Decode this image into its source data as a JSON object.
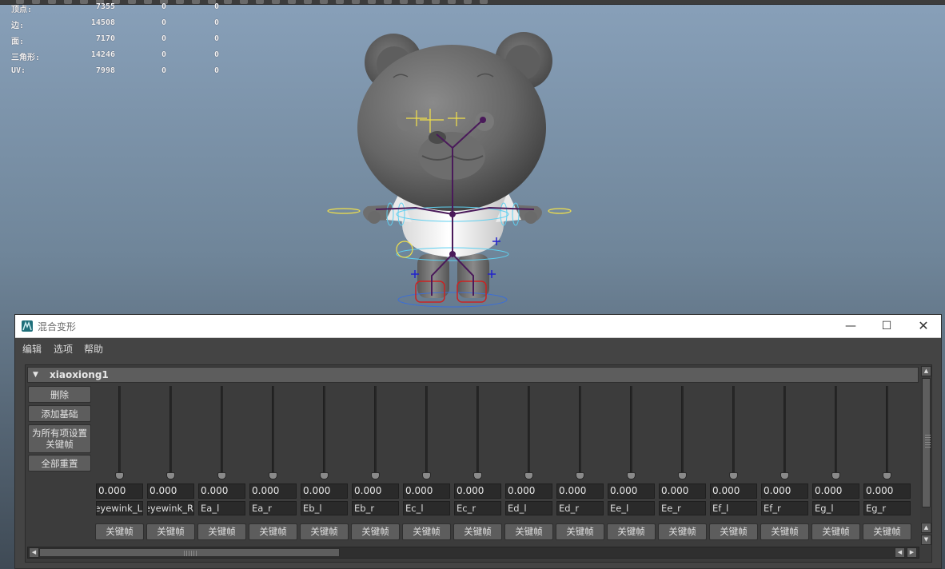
{
  "viewport": {
    "stats": [
      {
        "label": "顶点:",
        "v1": "7355",
        "v2": "0",
        "v3": "0"
      },
      {
        "label": "边:",
        "v1": "14508",
        "v2": "0",
        "v3": "0"
      },
      {
        "label": "面:",
        "v1": "7170",
        "v2": "0",
        "v3": "0"
      },
      {
        "label": "三角形:",
        "v1": "14246",
        "v2": "0",
        "v3": "0"
      },
      {
        "label": "UV:",
        "v1": "7998",
        "v2": "0",
        "v3": "0"
      }
    ]
  },
  "window": {
    "title": "混合变形",
    "controls": {
      "minimize": "—",
      "maximize": "☐",
      "close": "✕"
    }
  },
  "menu": {
    "items": [
      "编辑",
      "选项",
      "帮助"
    ]
  },
  "blendshape": {
    "node_name": "xiaoxiong1",
    "side_buttons": {
      "delete": "删除",
      "add_base": "添加基础",
      "key_all_line1": "为所有项设置",
      "key_all_line2": "关键帧",
      "reset_all": "全部重置"
    },
    "key_label": "关键帧",
    "targets": [
      {
        "name": "eyewink_L",
        "weight": "0.000"
      },
      {
        "name": "eyewink_R",
        "weight": "0.000"
      },
      {
        "name": "Ea_l",
        "weight": "0.000"
      },
      {
        "name": "Ea_r",
        "weight": "0.000"
      },
      {
        "name": "Eb_l",
        "weight": "0.000"
      },
      {
        "name": "Eb_r",
        "weight": "0.000"
      },
      {
        "name": "Ec_l",
        "weight": "0.000"
      },
      {
        "name": "Ec_r",
        "weight": "0.000"
      },
      {
        "name": "Ed_l",
        "weight": "0.000"
      },
      {
        "name": "Ed_r",
        "weight": "0.000"
      },
      {
        "name": "Ee_l",
        "weight": "0.000"
      },
      {
        "name": "Ee_r",
        "weight": "0.000"
      },
      {
        "name": "Ef_l",
        "weight": "0.000"
      },
      {
        "name": "Ef_r",
        "weight": "0.000"
      },
      {
        "name": "Eg_l",
        "weight": "0.000"
      },
      {
        "name": "Eg_r",
        "weight": "0.000"
      }
    ]
  },
  "colors": {
    "panel_bg": "#444444",
    "button_bg": "#5d5d5d",
    "field_bg": "#2a2a2a",
    "joint_color": "#4a1a5a",
    "control_yellow": "#f2e14a",
    "control_cyan": "#5fd0f0"
  }
}
